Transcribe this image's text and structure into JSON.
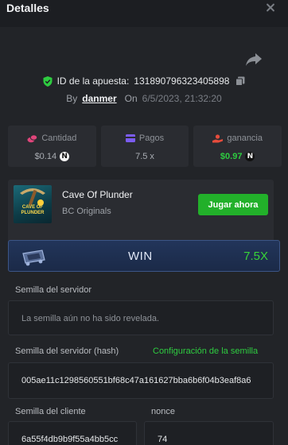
{
  "header": {
    "title": "Detalles"
  },
  "bet": {
    "id_label": "ID de la apuesta:",
    "id_value": "131890796323405898",
    "by_label": "By",
    "username": "danmer",
    "on_label": "On",
    "datetime": "6/5/2023, 21:32:20"
  },
  "stats": [
    {
      "label": "Cantidad",
      "value": "$0.14",
      "icon": "coins-icon",
      "coin": "N"
    },
    {
      "label": "Pagos",
      "value": "7.5 x",
      "icon": "wallet-icon"
    },
    {
      "label": "ganancia",
      "value": "$0.97",
      "icon": "profit-hand-icon",
      "coin": "N"
    }
  ],
  "game": {
    "name": "Cave Of Plunder",
    "provider": "BC Originals",
    "thumb_text": "CAVE OF PLUNDER",
    "play_label": "Jugar ahora"
  },
  "result": {
    "label": "WIN",
    "multiplier": "7.5X"
  },
  "server_seed": {
    "label": "Semilla del servidor",
    "value": "La semilla aún no ha sido revelada."
  },
  "server_hash": {
    "label": "Semilla del servidor (hash)",
    "config_label": "Configuración de la semilla",
    "value": "005ae11c1298560551bf68c47a161627bba6b6f04b3eaf8a6"
  },
  "client_seed": {
    "label": "Semilla del cliente",
    "value": "6a55f4db9b9f55a4bb5cc"
  },
  "nonce": {
    "label": "nonce",
    "value": "74"
  },
  "colors": {
    "background": "#222428",
    "card": "#2a2c31",
    "accent_green": "#2ecc40",
    "win_bar": "#1b2a48"
  }
}
